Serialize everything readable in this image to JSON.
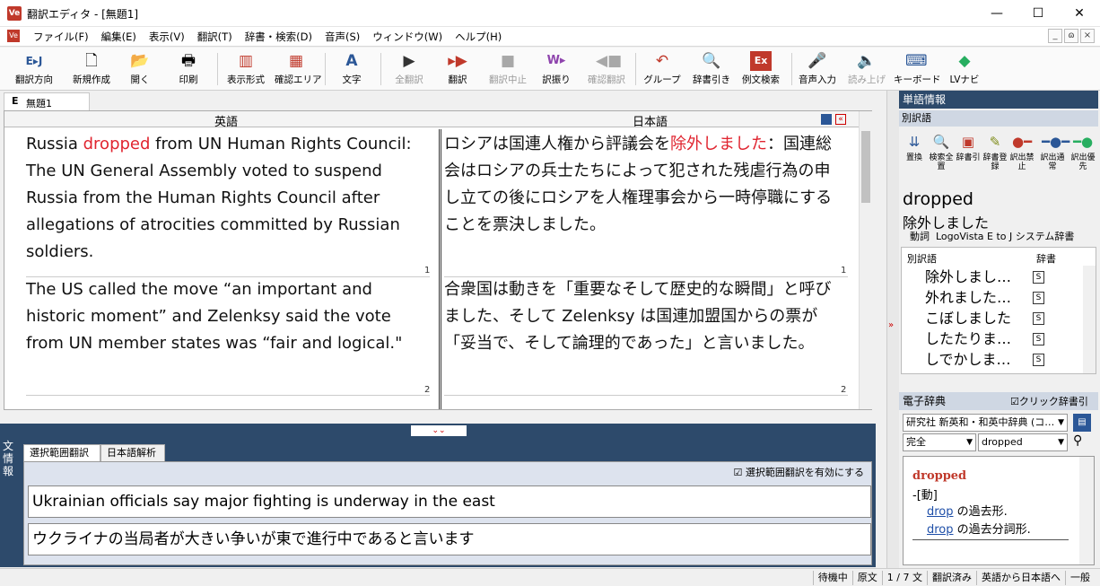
{
  "window": {
    "title": "翻訳エディタ - [無題1]",
    "app_icon": "Ve",
    "minimize": "—",
    "maximize": "☐",
    "close": "✕"
  },
  "menu": {
    "items": [
      "ファイル(F)",
      "編集(E)",
      "表示(V)",
      "翻訳(T)",
      "辞書・検索(D)",
      "音声(S)",
      "ウィンドウ(W)",
      "ヘルプ(H)"
    ],
    "mdi": [
      "_",
      "ɷ",
      "×"
    ]
  },
  "toolbar": {
    "direction": "翻訳方向",
    "new": "新規作成",
    "open": "開く",
    "print": "印刷",
    "display": "表示形式",
    "confirm_area": "確認エリア",
    "text": "文字",
    "translate_all": "全翻訳",
    "translate": "翻訳",
    "stop": "翻訳中止",
    "assign": "訳振り",
    "confirm_translate": "確認翻訳",
    "group": "グループ",
    "dict_lookup": "辞書引き",
    "example_search": "例文検索",
    "voice_input": "音声入力",
    "read_aloud": "読み上げ",
    "keyboard": "キーボード",
    "lv_navi": "LVナビ"
  },
  "document": {
    "tab_mark": "E",
    "tab_name": "無題1",
    "col_english": "英語",
    "col_japanese": "日本語",
    "segments": [
      {
        "num": "1",
        "en_pre": "Russia ",
        "en_hl": "dropped",
        "en_post": " from UN Human Rights Council: The UN General Assembly voted to suspend Russia from the Human Rights Council after allegations of atrocities committed by Russian soldiers.",
        "ja_pre": "ロシアは国連人権から評議会を",
        "ja_hl": "除外しました",
        "ja_post": "：国連総会はロシアの兵士たちによって犯された残虐行為の申し立ての後にロシアを人権理事会から一時停職にすることを票決しました。"
      },
      {
        "num": "2",
        "en": "The US called the move “an important and historic moment” and Zelenksy said the vote from UN member states was “fair and logical.\"",
        "ja": "合衆国は動きを「重要なそして歴史的な瞬間」と呼びました、そして Zelenksy は国連加盟国からの票が「妥当で、そして論理的であった」と言いました。"
      }
    ]
  },
  "bottom": {
    "side_label": "文情報",
    "tabs": [
      "選択範囲翻訳",
      "日本語解析"
    ],
    "enable_check": "選択範囲翻訳を有効にする",
    "source": "Ukrainian officials say major fighting is underway in the east",
    "target": "ウクライナの当局者が大きい争いが東で進行中であると言います"
  },
  "right": {
    "header": "単語情報",
    "sub": "別訳語",
    "icons": [
      "置換",
      "検索全置",
      "辞書引",
      "辞書登録",
      "訳出禁止",
      "訳出通常",
      "訳出優先"
    ],
    "word": "dropped",
    "word_ja": "除外しました",
    "pos": "動詞",
    "dict_name": "LogoVista E to J システム辞書",
    "list_col1": "別訳語",
    "list_col2": "辞書",
    "alternatives": [
      "除外しまし…",
      "外れました…",
      "こぼしました",
      "したたりま…",
      "しでかしま…"
    ],
    "badge": "S",
    "edict_header": "電子辞典",
    "click_check": "クリック辞書引",
    "dict_select": "研究社 新英和・和英中辞典 (コ…",
    "match_mode": "完全",
    "search_word": "dropped",
    "entry_word": "dropped",
    "entry_pos": "-[動]",
    "entry_lines": [
      {
        "link": "drop",
        "text": " の過去形."
      },
      {
        "link": "drop",
        "text": " の過去分詞形."
      }
    ]
  },
  "status": [
    "待機中",
    "原文",
    "1 / 7 文",
    "翻訳済み",
    "英語から日本語へ",
    "一般"
  ]
}
